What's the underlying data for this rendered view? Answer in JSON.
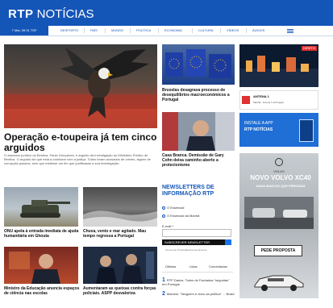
{
  "header": {
    "logo_rtp": "RTP",
    "logo_noticias": "NOTÍCIAS"
  },
  "nav": {
    "date": "7 Mar, 09:31 TSF",
    "items": [
      "Desporto",
      "País",
      "Mundo",
      "Política",
      "Economia",
      "Cultura",
      "Vídeos",
      "Áudios"
    ]
  },
  "main": {
    "headline": "Operação e-toupeira já tem cinco arguidos",
    "lead": "O assessor jurídico do Benfica, Paulo Gonçalves, e arguido da Investigação ao Ministério Público de Benfica. O arguido diz que está a colaborar com a justiça. Todos foram acusados de crimes, alguns de corrupção passiva, sem que existisse um fim que justificasse a sua investigação."
  },
  "articles": [
    {
      "title": "Bruxelas desagrava processo de desequilíbrios macroeconómicos a Portugal"
    },
    {
      "title": "Casa Branca. Demissão de Gary Cohn deixa caminho aberto a protecionismo"
    },
    {
      "title": "ONU apela à entrada imediata de ajuda humanitária em Ghouta"
    },
    {
      "title": "Chuva, vento e mar agitado. Mau tempo regressa a Portugal"
    },
    {
      "title": "Ministro da Educação anuncia espaços de ciência nas escolas"
    },
    {
      "title": "Aumentaram as queixas contra forças policiais. ASPP desvaloriza"
    }
  ],
  "sidebar": {
    "live_badge": "DIRETO",
    "antena": "ANTENA 1",
    "antena_sub": "Manhã · Antena 1 (Portugal)",
    "app_line1": "INSTALE A APP",
    "app_line2": "RTP NOTÍCIAS"
  },
  "newsletter": {
    "title": "NEWSLETTERS DE INFORMAÇÃO RTP",
    "options": [
      "O Essencial",
      "O Essencial da Manhã"
    ],
    "email_label": "E-mail *",
    "email_placeholder": "",
    "subscribe": "SUBSCREVER NEWSLETTER",
    "terms": "Termos de Privacidade/Consentimento"
  },
  "tabs": [
    "Últimas",
    "Lidas",
    "Comentadas"
  ],
  "most_read": [
    "RTP Dados. Todos de Fachadas \"seguidas\" em Portugal",
    "Marcelo: \"Ninguém é dono da política\" ... Brasil"
  ],
  "ad": {
    "brand": "VOLVO",
    "headline": "NOVO VOLVO XC40",
    "sub": "NADA MAIS DO QUE PRECISAS",
    "cta": "PEDE PROPOSTA"
  },
  "colors": {
    "brand_blue": "#1455b8",
    "live_red": "#e03030",
    "ad_bg": "#b9bdc2"
  }
}
